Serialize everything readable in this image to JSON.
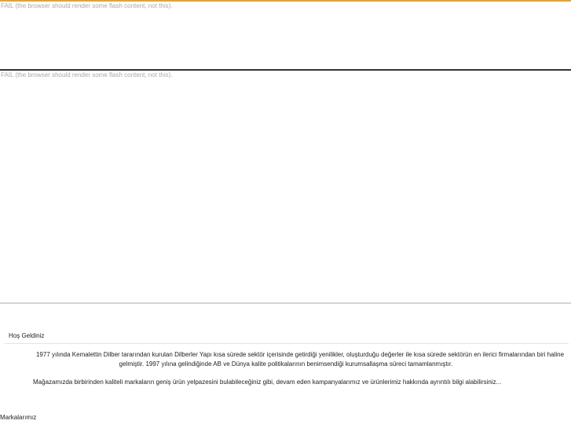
{
  "flash": {
    "fallback_top": "FAIL (the browser should render some flash content, not this).",
    "fallback_main": "FAIL (the browser should render some flash content, not this)."
  },
  "welcome": {
    "title": "Hoş Geldiniz",
    "paragraph_1": "1977 yılında Kemalettin Dilber tararından kurulan Dilberler Yapı kısa sürede sektör içerisinde getirdiği yenilikler, oluşturduğu değerler ile kısa sürede sektörün en ilerici firmalarından biri haline gelmiştir. 1997 yılına gelindiğinde AB ve Dünya kalite politikalarının benimsendiği kurumsallaşma süreci tamamlanmıştır.",
    "paragraph_2": "Mağazamızda birbirinden kaliteli markaların geniş ürün yelpazesini bulabileceğiniz gibi, devam eden kampanyalarımız ve ürünlerimiz hakkında ayrıntılı bilgi alabilirsiniz..."
  },
  "brands": {
    "title": "Markalarımız"
  },
  "colors": {
    "top_accent": "#f0a020",
    "fallback_text": "#aaaaaa"
  }
}
